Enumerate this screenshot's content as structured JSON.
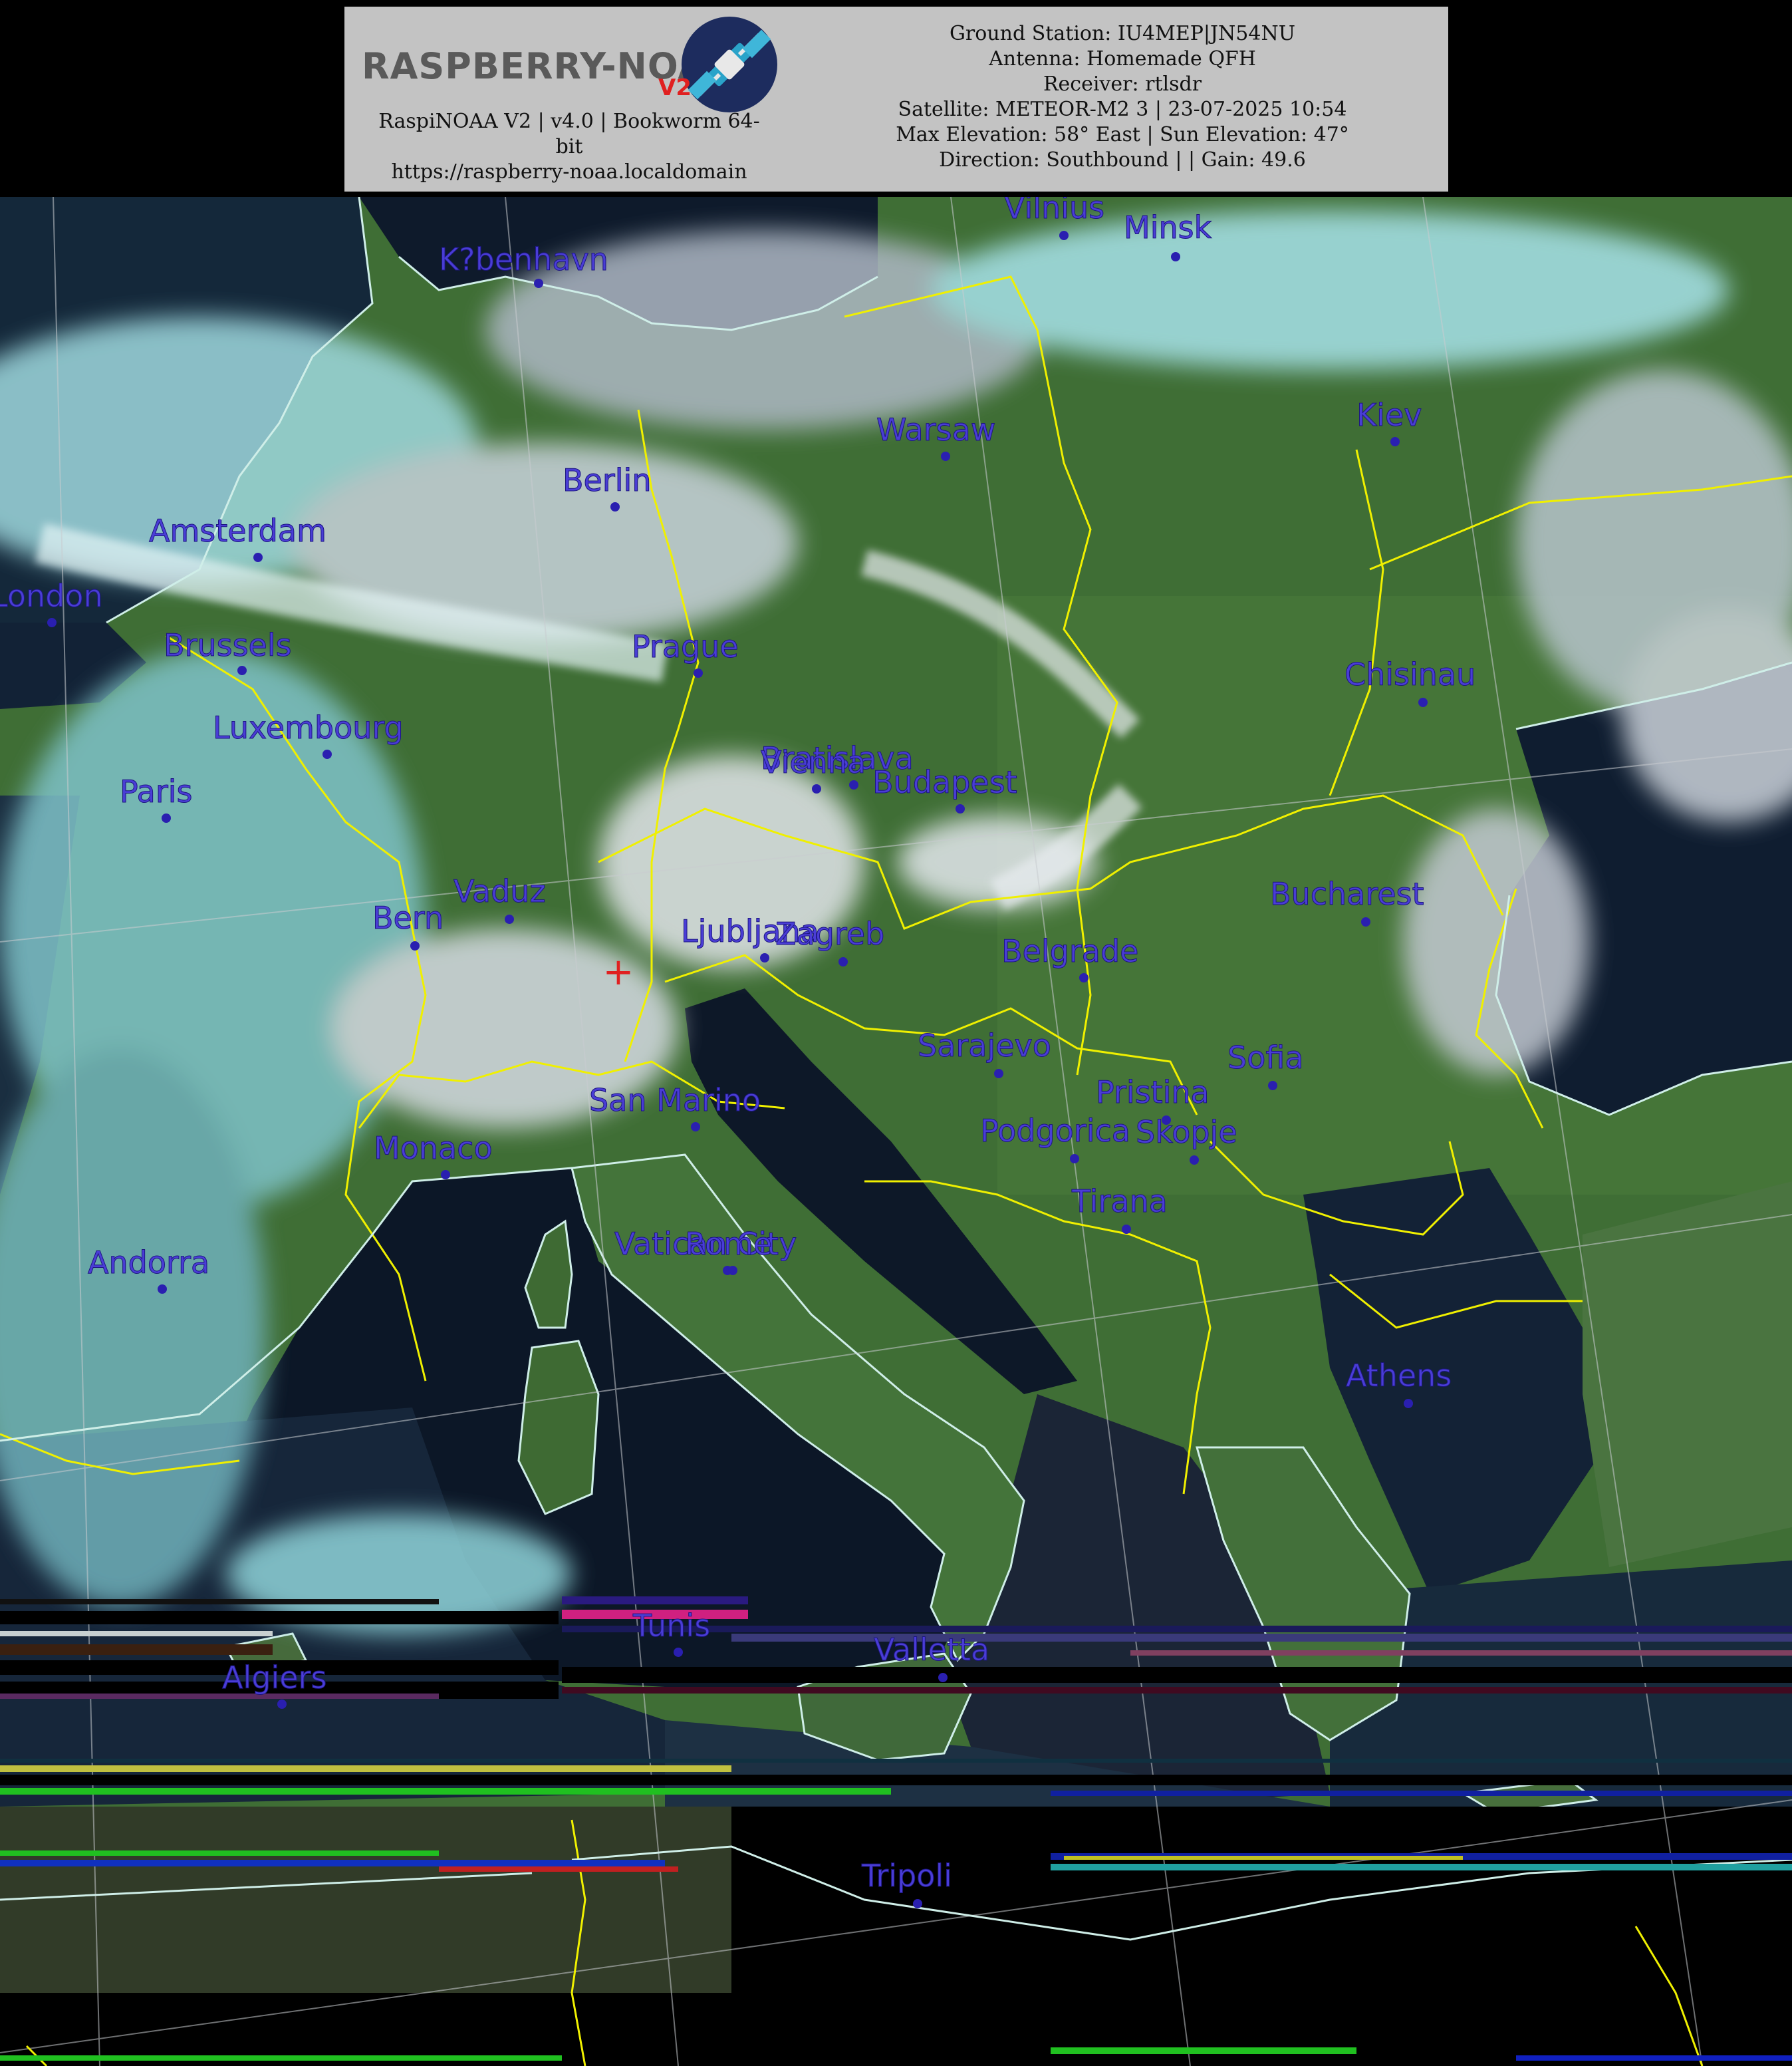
{
  "header": {
    "logo": {
      "text": "RASPBERRY-NOAA",
      "badge": "V2",
      "icon": "satellite-icon"
    },
    "app_info": {
      "line1": "RaspiNOAA V2 | v4.0 | Bookworm 64-",
      "line2": "bit",
      "url": "https://raspberry-noaa.localdomain"
    },
    "pass_info": {
      "ground_station": "Ground Station: IU4MEP|JN54NU",
      "antenna": "Antenna: Homemade QFH",
      "receiver": "Receiver: rtlsdr",
      "satellite": "Satellite: METEOR-M2 3 | 23-07-2025 10:54",
      "elevation": "Max Elevation: 58° East | Sun Elevation: 47°",
      "direction": "Direction: Southbound | | Gain: 49.6"
    }
  },
  "map": {
    "ground_station_marker": "+",
    "colors": {
      "borders": "#f0f000",
      "coastline": "#cfeee8",
      "city_label": "#4a3dd6",
      "marker": "#e02020",
      "land": "#3f6e35",
      "sea": "#0e1a2b",
      "cloud": "#9fd9df"
    },
    "cities": [
      {
        "name": "K?benhavn"
      },
      {
        "name": "Vilnius"
      },
      {
        "name": "Minsk"
      },
      {
        "name": "Warsaw"
      },
      {
        "name": "Kiev"
      },
      {
        "name": "Berlin"
      },
      {
        "name": "Amsterdam"
      },
      {
        "name": "London"
      },
      {
        "name": "Brussels"
      },
      {
        "name": "Prague"
      },
      {
        "name": "Chisinau"
      },
      {
        "name": "Luxembourg"
      },
      {
        "name": "Bratislava"
      },
      {
        "name": "Vienna"
      },
      {
        "name": "Budapest"
      },
      {
        "name": "Paris"
      },
      {
        "name": "Vaduz"
      },
      {
        "name": "Bern"
      },
      {
        "name": "Bucharest"
      },
      {
        "name": "Ljubljana"
      },
      {
        "name": "Zagreb"
      },
      {
        "name": "Belgrade"
      },
      {
        "name": "Sarajevo"
      },
      {
        "name": "Sofia"
      },
      {
        "name": "Pristina"
      },
      {
        "name": "San Marino"
      },
      {
        "name": "Podgorica"
      },
      {
        "name": "Skopje"
      },
      {
        "name": "Monaco"
      },
      {
        "name": "Tirana"
      },
      {
        "name": "Vatican City"
      },
      {
        "name": "Rome"
      },
      {
        "name": "Andorra"
      },
      {
        "name": "Athens"
      },
      {
        "name": "Tunis"
      },
      {
        "name": "Valletta"
      },
      {
        "name": "Algiers"
      },
      {
        "name": "Tripoli"
      }
    ]
  }
}
